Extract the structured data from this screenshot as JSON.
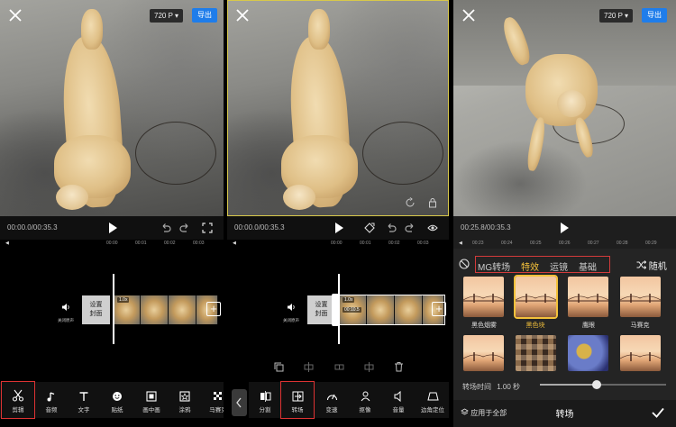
{
  "common": {
    "resolution": "720 P",
    "export_label": "导出"
  },
  "panel1": {
    "timecode": "00:00.0/00:35.3",
    "ruler_ticks": [
      "00:00",
      "00:01",
      "00:02",
      "00:03"
    ],
    "mute_label": "关闭原声",
    "cover_label_1": "设置",
    "cover_label_2": "封面",
    "speed_badge": "1.0x",
    "tools": [
      "剪辑",
      "音频",
      "文字",
      "贴纸",
      "画中画",
      "涂鸦",
      "马赛克"
    ]
  },
  "panel2": {
    "timecode": "00:00.0/00:35.3",
    "ruler_ticks": [
      "00:00",
      "00:01",
      "00:02",
      "00:03"
    ],
    "mute_label": "关闭原声",
    "cover_label_1": "设置",
    "cover_label_2": "封面",
    "speed_badge": "1.0x",
    "clip_duration": "00:10.5",
    "tools": [
      "分割",
      "转场",
      "变速",
      "抠像",
      "音量",
      "边角定位"
    ]
  },
  "panel3": {
    "timecode": "00:25.8/00:35.3",
    "ruler_ticks": [
      "00:23",
      "00:24",
      "00:25",
      "00:26",
      "00:27",
      "00:28",
      "00:29"
    ],
    "tabs": [
      "MG转场",
      "特效",
      "运镜",
      "基础"
    ],
    "selected_tab": "特效",
    "random_label": "随机",
    "effects_row1": [
      "黑色烟雾",
      "黑色块",
      "鹰眼",
      "马赛克"
    ],
    "selected_effect": "黑色块",
    "duration_label": "转场时间",
    "duration_value": "1.00 秒",
    "duration_fraction": 0.45,
    "apply_all_label": "应用于全部",
    "bottom_title": "转场"
  }
}
